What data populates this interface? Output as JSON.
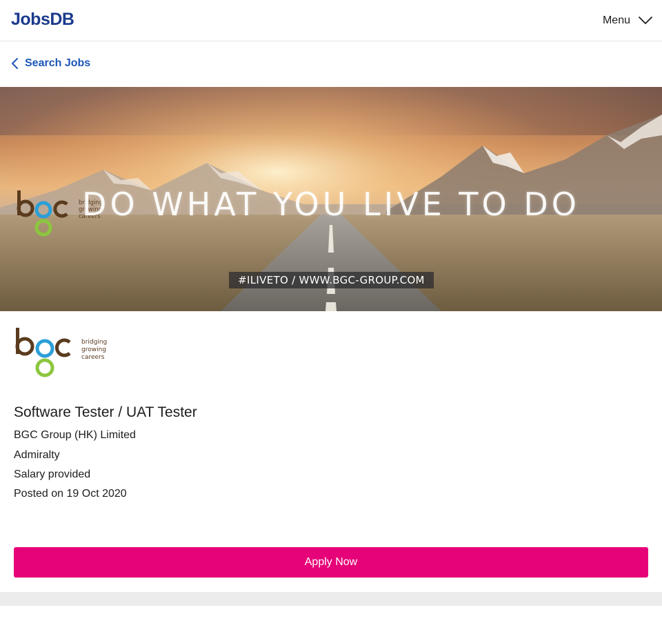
{
  "header": {
    "logo_text": "JobsDB",
    "menu_label": "Menu",
    "menu_icon": "chevron-down-icon"
  },
  "nav": {
    "back_label": "Search Jobs",
    "back_icon": "chevron-left-icon"
  },
  "banner": {
    "headline": "DO WHAT YOU LIVE TO DO",
    "tag": "#ILIVETO  / WWW.BGC-GROUP.COM",
    "logo": {
      "mark": "bgc",
      "tagline": [
        "bridging",
        "growing",
        "careers"
      ]
    }
  },
  "company_logo": {
    "mark": "bgc",
    "tagline": [
      "bridging",
      "growing",
      "careers"
    ]
  },
  "job": {
    "title": "Software Tester / UAT Tester",
    "company": "BGC Group (HK) Limited",
    "location": "Admiralty",
    "salary": "Salary provided",
    "posted": "Posted on 19 Oct 2020"
  },
  "actions": {
    "apply_label": "Apply Now"
  },
  "colors": {
    "brand_blue": "#1c3b8c",
    "link_blue": "#1c57b8",
    "apply_pink": "#e60278",
    "bgc_brown": "#5a3b1e",
    "bgc_blue": "#2a9fd8",
    "bgc_green": "#8cc63f"
  }
}
